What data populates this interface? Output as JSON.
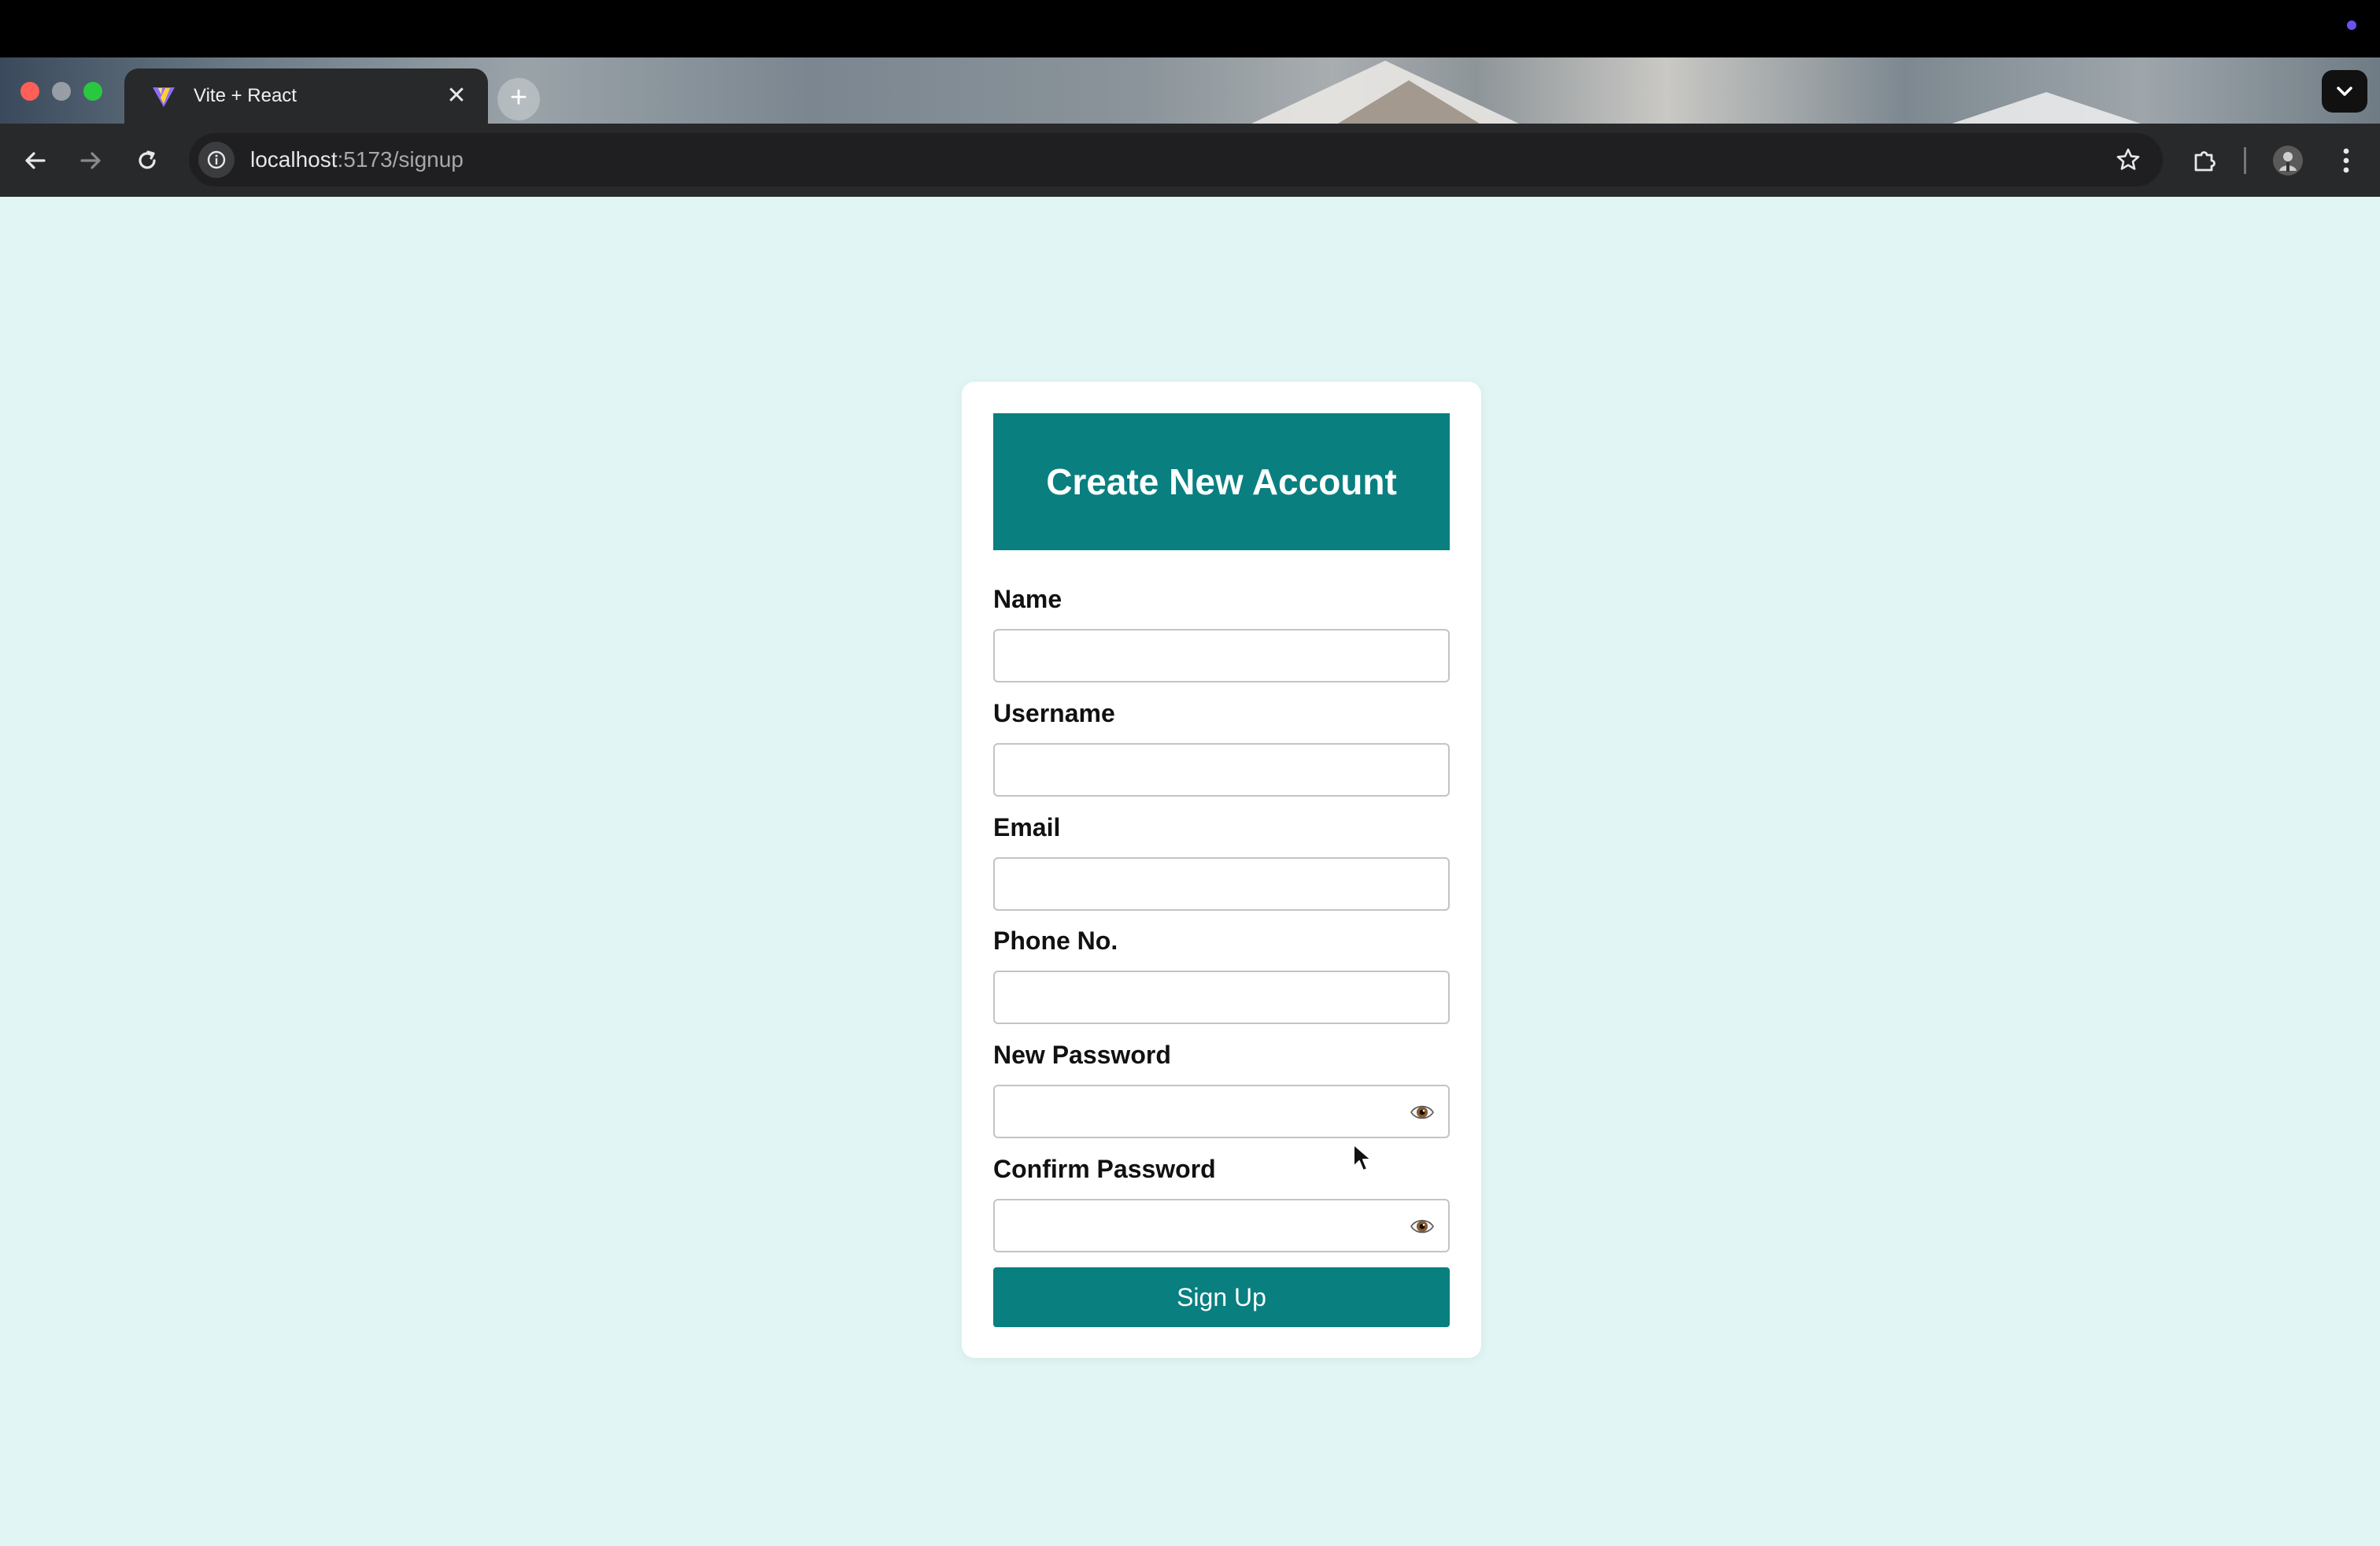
{
  "browser": {
    "tab": {
      "title": "Vite + React",
      "close_glyph": "✕",
      "favicon": "vite-logo-icon"
    },
    "new_tab_glyph": "+",
    "address": {
      "host": "localhost",
      "path": ":5173/signup"
    },
    "icons": [
      "back-arrow-icon",
      "forward-arrow-icon",
      "reload-icon",
      "site-info-icon",
      "bookmark-star-icon",
      "extensions-puzzle-icon",
      "profile-avatar-icon",
      "kebab-menu-icon",
      "tab-search-chevron-icon"
    ]
  },
  "page": {
    "background_color": "#e1f6f4",
    "accent_color": "#097f80",
    "form": {
      "title": "Create New Account",
      "fields": [
        {
          "label": "Name",
          "value": "",
          "type": "text"
        },
        {
          "label": "Username",
          "value": "",
          "type": "text"
        },
        {
          "label": "Email",
          "value": "",
          "type": "email"
        },
        {
          "label": "Phone No.",
          "value": "",
          "type": "tel"
        },
        {
          "label": "New Password",
          "value": "",
          "type": "password",
          "toggle_icon": "eye-icon"
        },
        {
          "label": "Confirm Password",
          "value": "",
          "type": "password",
          "toggle_icon": "eye-icon"
        }
      ],
      "submit_label": "Sign Up"
    }
  }
}
